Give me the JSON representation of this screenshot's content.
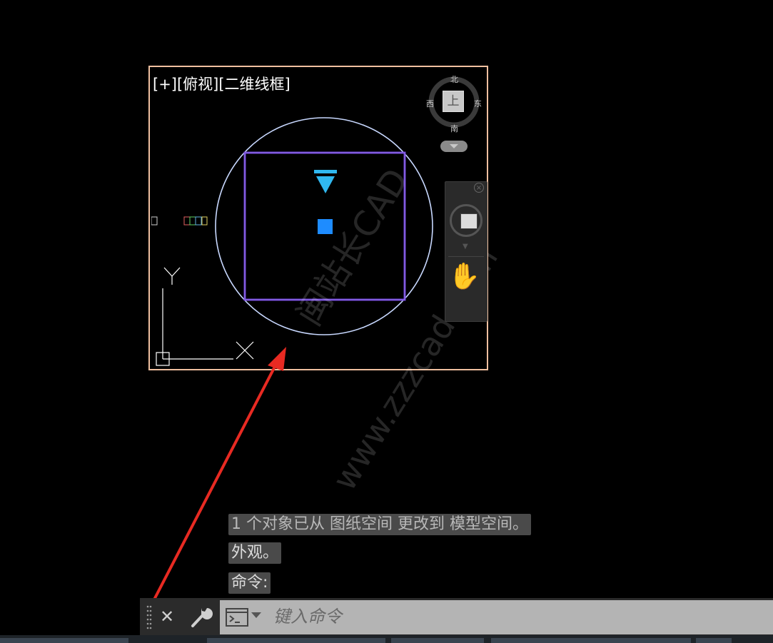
{
  "viewport": {
    "label": "[+][俯视][二维线框]"
  },
  "viewcube": {
    "north": "北",
    "south": "南",
    "east": "东",
    "west": "西",
    "face": "上"
  },
  "watermark": {
    "line1": "闽站长CAD",
    "line2": "www.zzzcad.com"
  },
  "ucs": {
    "x_label": "X",
    "y_label": "Y"
  },
  "command_history": [
    "1 个对象已从 图纸空间 更改到 模型空间。",
    "外观。",
    "命令:"
  ],
  "command_line": {
    "placeholder": "键入命令",
    "close_glyph": "✕"
  },
  "colors": {
    "viewport_border": "#f0c0a0",
    "circle": "#c8d8ff",
    "square": "#7b4bd8",
    "camera": "#30b8f0",
    "target": "#1e8cff",
    "arrow": "#e82a22"
  },
  "icons": [
    "viewcube-compass-icon",
    "wcs-dropdown-icon",
    "steering-wheel-icon",
    "pan-hand-icon",
    "close-icon",
    "wrench-icon",
    "command-prompt-icon",
    "grip-icon"
  ]
}
